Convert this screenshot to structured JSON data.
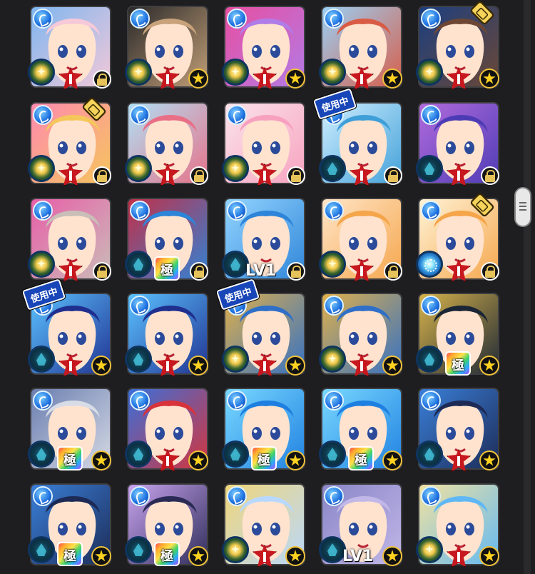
{
  "screen": "monster-box-grid",
  "badge_texts": {
    "in_use": "使用中",
    "extreme": "極",
    "level_one": "LV1"
  },
  "scroll": {
    "thumb_label": "scroll-handle"
  },
  "cards": [
    {
      "element": "water",
      "ability": "gold",
      "bottom": "rank",
      "lock": true,
      "art": [
        "#f6c9d8",
        "#7fb6f0"
      ]
    },
    {
      "element": "water",
      "ability": "gold",
      "bottom": "rank",
      "star": true,
      "art": [
        "#c7a27a",
        "#2a2a2a"
      ]
    },
    {
      "element": "water",
      "ability": "gold",
      "bottom": "rank",
      "star": true,
      "art": [
        "#b07ce8",
        "#e84fa1"
      ]
    },
    {
      "element": "water",
      "ability": "gold",
      "bottom": "rank",
      "star": true,
      "art": [
        "#d95b45",
        "#9ad0f5"
      ]
    },
    {
      "element": "water",
      "ability": "gold",
      "bottom": "rank",
      "star": true,
      "pair": true,
      "art": [
        "#6d4733",
        "#1c3f80"
      ]
    },
    {
      "element": "water",
      "ability": "gold",
      "bottom": "rank",
      "lock": true,
      "pair": true,
      "art": [
        "#f5c75a",
        "#ff8ab0"
      ]
    },
    {
      "element": "water",
      "ability": "gold",
      "bottom": "rank",
      "lock": true,
      "art": [
        "#e86f86",
        "#b0e0f5"
      ]
    },
    {
      "element": "water",
      "ability": "gold",
      "bottom": "rank",
      "lock": true,
      "art": [
        "#f7a1bf",
        "#fbe3ea"
      ]
    },
    {
      "element": "water",
      "ability": "dark",
      "bottom": "rank",
      "lock": true,
      "in_use": true,
      "art": [
        "#3f9fd8",
        "#cfeeff"
      ]
    },
    {
      "element": "water",
      "ability": "dark",
      "bottom": "rank",
      "lock": true,
      "art": [
        "#4d3bb5",
        "#b06bdc"
      ]
    },
    {
      "element": "water",
      "ability": "gold",
      "bottom": "rank",
      "lock": true,
      "art": [
        "#c9bfb8",
        "#e85fa8"
      ]
    },
    {
      "element": "water",
      "ability": "dark",
      "bottom": "extreme",
      "lock": true,
      "art": [
        "#2d84d8",
        "#c23049"
      ]
    },
    {
      "element": "water",
      "ability": "dark",
      "bottom": "level",
      "lock": true,
      "art": [
        "#2d84d8",
        "#93d4ff"
      ]
    },
    {
      "element": "water",
      "ability": "gold",
      "bottom": "rank",
      "lock": true,
      "art": [
        "#f5a54a",
        "#ffe5c7"
      ]
    },
    {
      "element": "water",
      "ability": "blue",
      "bottom": "rank",
      "lock": true,
      "pair": true,
      "art": [
        "#f5a54a",
        "#fff3d6"
      ]
    },
    {
      "element": "water",
      "ability": "dark",
      "bottom": "rank",
      "star": true,
      "in_use": true,
      "art": [
        "#1f2f8f",
        "#5bc2ff"
      ]
    },
    {
      "element": "water",
      "ability": "dark",
      "bottom": "rank",
      "star": true,
      "art": [
        "#1f2f8f",
        "#5bc2ff"
      ]
    },
    {
      "element": "water",
      "ability": "gold",
      "bottom": "rank",
      "star": true,
      "in_use": true,
      "art": [
        "#2f6fc8",
        "#e0b04a"
      ]
    },
    {
      "element": "water",
      "ability": "gold",
      "bottom": "rank",
      "star": true,
      "art": [
        "#2f6fc8",
        "#e0b04a"
      ]
    },
    {
      "element": "water",
      "ability": "dark",
      "bottom": "extreme",
      "star": true,
      "art": [
        "#1a2535",
        "#d6b24a"
      ]
    },
    {
      "element": "water",
      "ability": "dark",
      "bottom": "extreme",
      "star": true,
      "art": [
        "#d8dce6",
        "#6b7fb0"
      ]
    },
    {
      "element": "water",
      "ability": "dark",
      "bottom": "rank",
      "star": true,
      "art": [
        "#d8333a",
        "#3b6fd8"
      ]
    },
    {
      "element": "water",
      "ability": "dark",
      "bottom": "extreme",
      "star": true,
      "art": [
        "#1f7fe0",
        "#78d8ff"
      ]
    },
    {
      "element": "water",
      "ability": "dark",
      "bottom": "extreme",
      "star": true,
      "art": [
        "#1f7fe0",
        "#78d8ff"
      ]
    },
    {
      "element": "water",
      "ability": "dark",
      "bottom": "rank",
      "star": true,
      "art": [
        "#1c2a55",
        "#3a7fd8"
      ]
    },
    {
      "element": "water",
      "ability": "dark",
      "bottom": "extreme",
      "star": true,
      "art": [
        "#1c2a55",
        "#3a7fd8"
      ]
    },
    {
      "element": "water",
      "ability": "dark",
      "bottom": "extreme",
      "star": true,
      "art": [
        "#2a2a55",
        "#c9a4ef"
      ]
    },
    {
      "element": "water",
      "ability": "gold",
      "bottom": "rank",
      "star": true,
      "art": [
        "#b8d8ff",
        "#f0d67a"
      ]
    },
    {
      "element": "water",
      "ability": "dark",
      "bottom": "level",
      "star": true,
      "art": [
        "#c2b8e8",
        "#8a86c8"
      ]
    },
    {
      "element": "water",
      "ability": "gold",
      "bottom": "rank",
      "star": true,
      "art": [
        "#5fb8f5",
        "#f2e2a0"
      ]
    }
  ]
}
